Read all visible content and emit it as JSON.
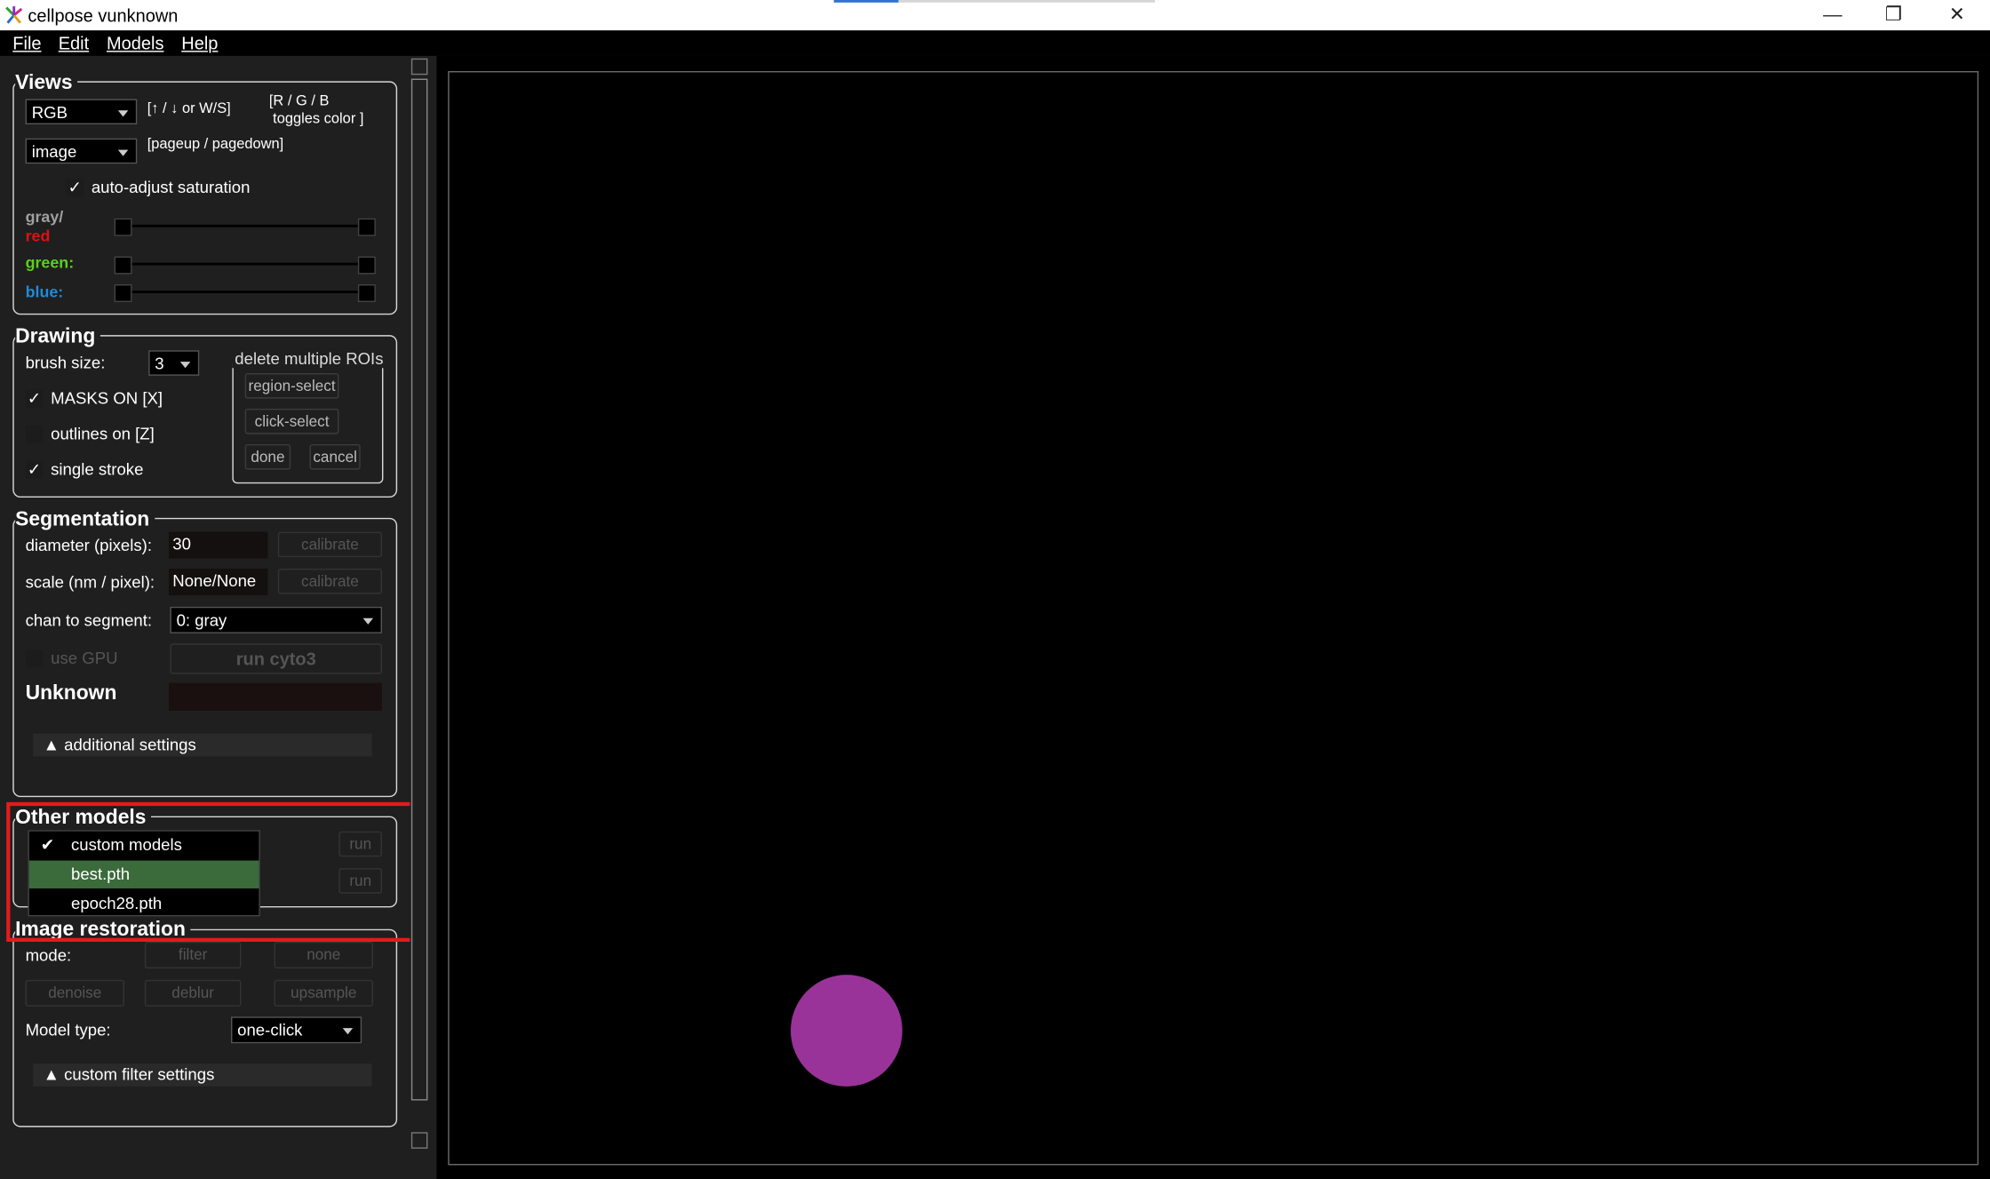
{
  "window": {
    "title": "cellpose vunknown",
    "minimize_glyph": "—",
    "restore_glyph": "❐",
    "close_glyph": "✕"
  },
  "menu": {
    "file": "File",
    "edit": "Edit",
    "models": "Models",
    "help": "Help"
  },
  "views": {
    "title": "Views",
    "color_mode": "RGB",
    "color_mode_hint": "[↑ / ↓ or W/S]",
    "rgb_toggle_hint_line1": "[R / G / B",
    "rgb_toggle_hint_line2": "toggles color ]",
    "view_mode": "image",
    "view_mode_hint": "[pageup / pagedown]",
    "auto_saturation_label": "auto-adjust saturation",
    "auto_saturation_checked": "✓",
    "gray_label": "gray/",
    "red_label": "red",
    "green_label": "green:",
    "blue_label": "blue:",
    "colors": {
      "red": "#e01010",
      "green": "#59d11c",
      "blue": "#1f8bdc",
      "gray": "#a0a0a0"
    }
  },
  "drawing": {
    "title": "Drawing",
    "brush_size_label": "brush size:",
    "brush_size": "3",
    "masks_on_label": "MASKS ON [X]",
    "masks_on_checked": "✓",
    "outlines_label": "outlines on [Z]",
    "single_stroke_label": "single stroke",
    "single_stroke_checked": "✓",
    "delete_group_title": "delete multiple ROIs",
    "region_select": "region-select",
    "click_select": "click-select",
    "done": "done",
    "cancel": "cancel"
  },
  "segmentation": {
    "title": "Segmentation",
    "diameter_label": "diameter (pixels):",
    "diameter_value": "30",
    "calibrate": "calibrate",
    "scale_label": "scale (nm / pixel):",
    "scale_value": "None/None",
    "chan_label": "chan to segment:",
    "chan_value": "0: gray",
    "use_gpu_label": "use GPU",
    "run_button": "run cyto3",
    "model_name": "Unknown",
    "additional_settings": "▲ additional settings"
  },
  "other_models": {
    "title": "Other models",
    "run": "run",
    "dropdown_items": [
      {
        "label": "custom models",
        "check": "✔"
      },
      {
        "label": "best.pth",
        "check": ""
      },
      {
        "label": "epoch28.pth",
        "check": ""
      }
    ],
    "highlight_color": "#e21b1b"
  },
  "image_restoration": {
    "title": "Image restoration",
    "mode_label": "mode:",
    "filter": "filter",
    "none": "none",
    "denoise": "denoise",
    "deblur": "deblur",
    "upsample": "upsample",
    "model_type_label": "Model type:",
    "model_type_value": "one-click",
    "custom_filter_settings": "▲ custom filter settings"
  },
  "viewer": {
    "mask_color": "#993399"
  }
}
